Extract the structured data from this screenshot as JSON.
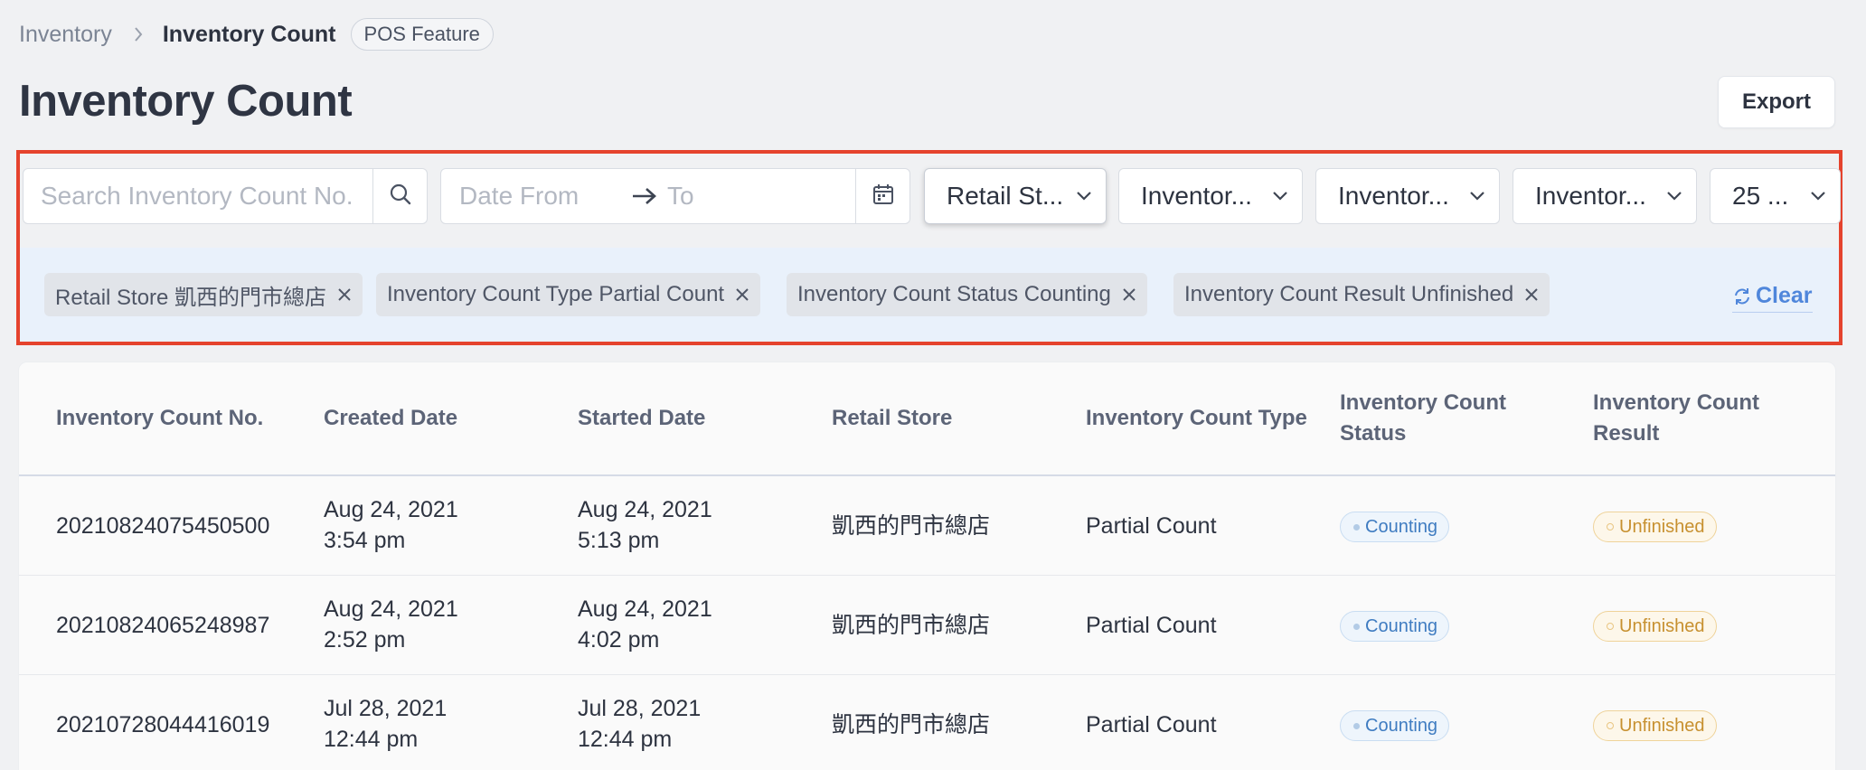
{
  "breadcrumb": {
    "parent": "Inventory",
    "current": "Inventory Count",
    "badge": "POS Feature"
  },
  "page": {
    "title": "Inventory Count",
    "export_label": "Export"
  },
  "filters": {
    "search_placeholder": "Search Inventory Count No.",
    "date_from_placeholder": "Date From",
    "date_to_placeholder": "To",
    "selects": [
      "Retail St...",
      "Inventor...",
      "Inventor...",
      "Inventor...",
      "25 ..."
    ]
  },
  "active_tags": [
    "Retail Store 凱西的門市總店",
    "Inventory Count Type Partial Count",
    "Inventory Count Status Counting",
    "Inventory Count Result Unfinished"
  ],
  "clear_label": "Clear",
  "table": {
    "columns": [
      "Inventory Count No.",
      "Created Date",
      "Started Date",
      "Retail Store",
      "Inventory Count Type",
      "Inventory Count Status",
      "Inventory Count Result"
    ],
    "rows": [
      {
        "no": "20210824075450500",
        "created_date": "Aug 24, 2021",
        "created_time": "3:54 pm",
        "started_date": "Aug 24, 2021",
        "started_time": "5:13 pm",
        "store": "凱西的門市總店",
        "type": "Partial Count",
        "status": "Counting",
        "result": "Unfinished"
      },
      {
        "no": "20210824065248987",
        "created_date": "Aug 24, 2021",
        "created_time": "2:52 pm",
        "started_date": "Aug 24, 2021",
        "started_time": "4:02 pm",
        "store": "凱西的門市總店",
        "type": "Partial Count",
        "status": "Counting",
        "result": "Unfinished"
      },
      {
        "no": "20210728044416019",
        "created_date": "Jul 28, 2021",
        "created_time": "12:44 pm",
        "started_date": "Jul 28, 2021",
        "started_time": "12:44 pm",
        "store": "凱西的門市總店",
        "type": "Partial Count",
        "status": "Counting",
        "result": "Unfinished"
      }
    ]
  },
  "colors": {
    "highlight_border": "#e5432d",
    "status_blue": "#3f7cc1",
    "result_amber": "#c7902f",
    "link_blue": "#4f86db"
  },
  "icons": [
    "chevron-right-icon",
    "search-icon",
    "arrow-right-icon",
    "calendar-icon",
    "chevron-down-icon",
    "close-icon",
    "refresh-icon"
  ]
}
